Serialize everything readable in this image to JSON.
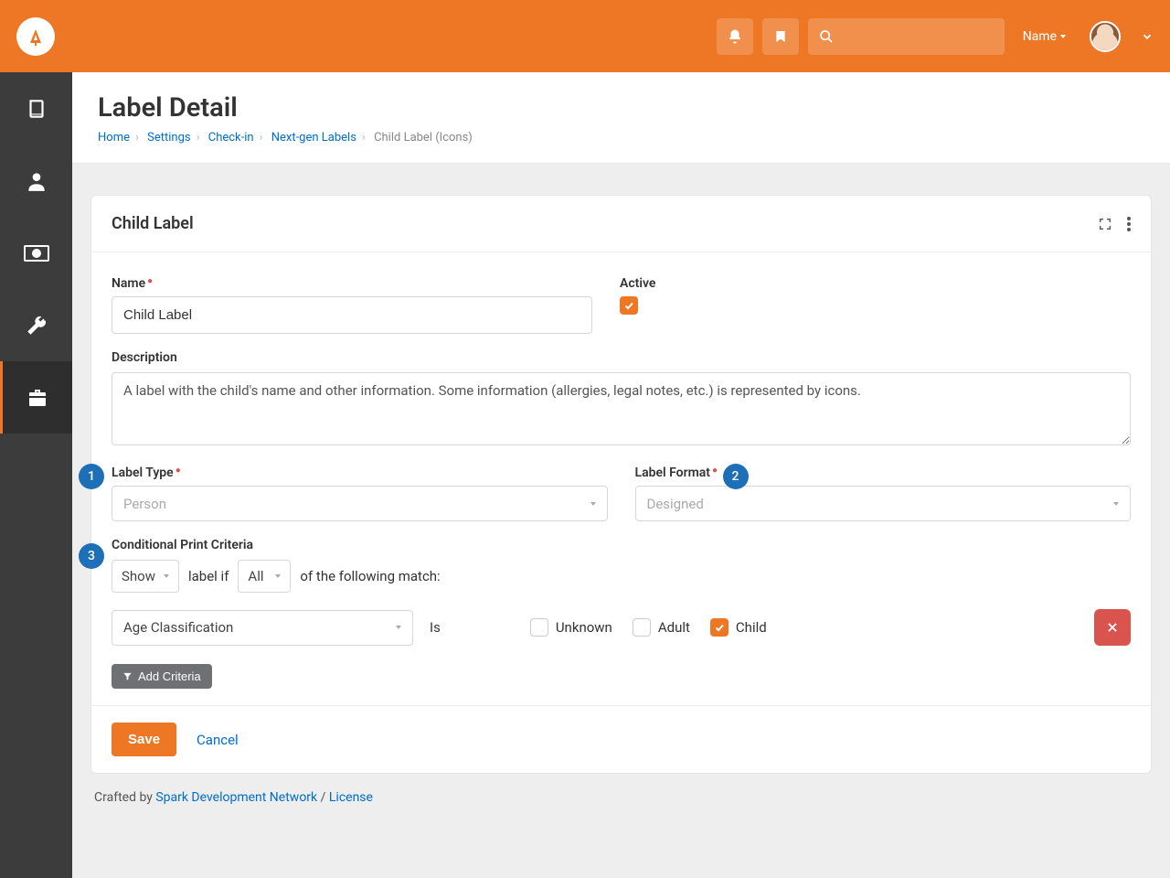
{
  "header": {
    "name_label": "Name"
  },
  "page": {
    "title": "Label Detail"
  },
  "breadcrumb": {
    "home": "Home",
    "settings": "Settings",
    "checkin": "Check-in",
    "nextgen": "Next-gen Labels",
    "current": "Child Label (Icons)"
  },
  "panel": {
    "title": "Child Label"
  },
  "form": {
    "name_label": "Name",
    "name_value": "Child Label",
    "active_label": "Active",
    "desc_label": "Description",
    "desc_value": "A label with the child's name and other information. Some information (allergies, legal notes, etc.) is represented by icons.",
    "label_type_label": "Label Type",
    "label_type_value": "Person",
    "label_format_label": "Label Format",
    "label_format_value": "Designed",
    "criteria_label": "Conditional Print Criteria",
    "show_value": "Show",
    "label_if_text": "label if",
    "all_value": "All",
    "following_text": "of the following match:",
    "crit_select_value": "Age Classification",
    "is_text": "Is",
    "opt_unknown": "Unknown",
    "opt_adult": "Adult",
    "opt_child": "Child",
    "add_criteria": "Add Criteria",
    "save": "Save",
    "cancel": "Cancel"
  },
  "callouts": {
    "c1": "1",
    "c2": "2",
    "c3": "3"
  },
  "footer": {
    "crafted": "Crafted by ",
    "spark": "Spark Development Network",
    "sep": " / ",
    "license": "License"
  }
}
